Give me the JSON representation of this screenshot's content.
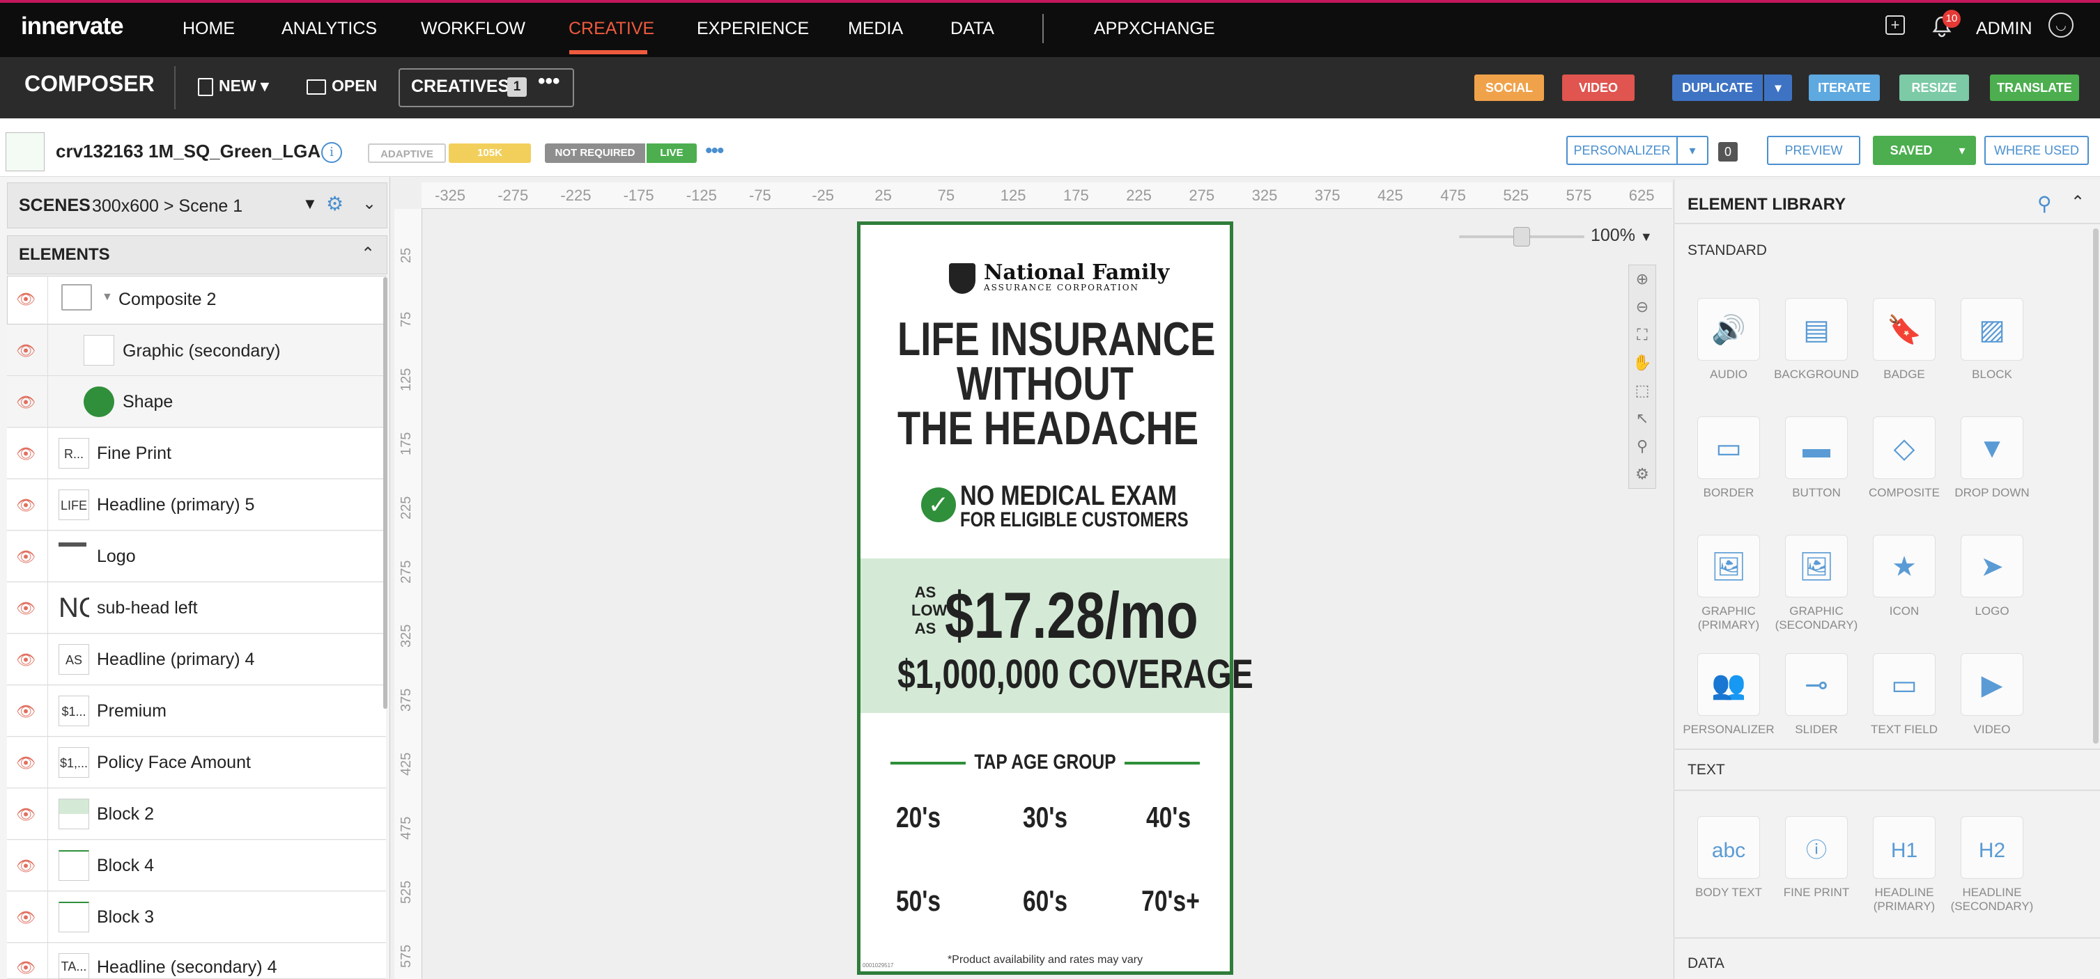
{
  "nav": {
    "brand": "innervate",
    "items": [
      "HOME",
      "ANALYTICS",
      "WORKFLOW",
      "CREATIVE",
      "EXPERIENCE",
      "MEDIA",
      "DATA",
      "APPXCHANGE"
    ],
    "notification_count": "10",
    "user": "ADMIN"
  },
  "composer": {
    "title": "COMPOSER",
    "new_label": "NEW",
    "open_label": "OPEN",
    "creatives_label": "CREATIVES",
    "creatives_count": "1",
    "actions": [
      "SOCIAL",
      "VIDEO",
      "DUPLICATE",
      "ITERATE",
      "RESIZE",
      "TRANSLATE"
    ],
    "action_colors": [
      "#f0a24a",
      "#e0554f",
      "#3e73c4",
      "#5ea9e0",
      "#7ccaa6",
      "#4cae4f"
    ]
  },
  "creative": {
    "name": "crv132163 1M_SQ_Green_LGA",
    "chips": [
      "ADAPTIVE",
      "105K",
      "NOT REQUIRED",
      "LIVE"
    ],
    "personalizer_label": "PERSONALIZER",
    "personalizer_count": "0",
    "preview_label": "PREVIEW",
    "saved_label": "SAVED",
    "where_used_label": "WHERE USED"
  },
  "scenes": {
    "label": "SCENES",
    "value": "300x600 > Scene 1"
  },
  "elements": {
    "label": "ELEMENTS",
    "rows": [
      {
        "name": "Composite 2",
        "thumb": ""
      },
      {
        "name": "Graphic (secondary)",
        "thumb": ""
      },
      {
        "name": "Shape",
        "thumb": ""
      },
      {
        "name": "Fine Print",
        "thumb": "R..."
      },
      {
        "name": "Headline (primary) 5",
        "thumb": "LIFE"
      },
      {
        "name": "Logo",
        "thumb": ""
      },
      {
        "name": "sub-head left",
        "thumb": "NO"
      },
      {
        "name": "Headline (primary) 4",
        "thumb": "AS"
      },
      {
        "name": "Premium",
        "thumb": "$1..."
      },
      {
        "name": "Policy Face Amount",
        "thumb": "$1,..."
      },
      {
        "name": "Block 2",
        "thumb": ""
      },
      {
        "name": "Block 4",
        "thumb": ""
      },
      {
        "name": "Block 3",
        "thumb": ""
      },
      {
        "name": "Headline (secondary) 4",
        "thumb": "TA..."
      }
    ]
  },
  "canvas": {
    "zoom": "100%",
    "ruler_top": [
      "-325",
      "-275",
      "-225",
      "-175",
      "-125",
      "-75",
      "-25",
      "25",
      "75",
      "125",
      "175",
      "225",
      "275",
      "325",
      "375",
      "425",
      "475",
      "525",
      "575",
      "625"
    ],
    "ruler_left": [
      "25",
      "75",
      "125",
      "175",
      "225",
      "275",
      "325",
      "375",
      "425",
      "475",
      "525",
      "575"
    ]
  },
  "ad": {
    "brand": "National Family",
    "brand_sub": "ASSURANCE CORPORATION",
    "headline": [
      "LIFE INSURANCE",
      "WITHOUT",
      "THE HEADACHE"
    ],
    "sub1": "NO MEDICAL EXAM",
    "sub2": "FOR ELIGIBLE CUSTOMERS",
    "as_low_as": [
      "AS",
      "LOW",
      "AS"
    ],
    "price": "$17.28/mo",
    "coverage": "$1,000,000 COVERAGE",
    "tap": "TAP AGE GROUP",
    "ages": [
      "20's",
      "30's",
      "40's",
      "50's",
      "60's",
      "70's+"
    ],
    "disclaimer": "*Product availability and rates may vary",
    "code": "0001029517"
  },
  "library": {
    "title": "ELEMENT LIBRARY",
    "standard_label": "STANDARD",
    "standard": [
      "AUDIO",
      "BACKGROUND",
      "BADGE",
      "BLOCK",
      "BORDER",
      "BUTTON",
      "COMPOSITE",
      "DROP DOWN",
      "GRAPHIC (PRIMARY)",
      "GRAPHIC (SECONDARY)",
      "ICON",
      "LOGO",
      "PERSONALIZER",
      "SLIDER",
      "TEXT FIELD",
      "VIDEO"
    ],
    "text_label": "TEXT",
    "text": [
      "BODY TEXT",
      "FINE PRINT",
      "HEADLINE (PRIMARY)",
      "HEADLINE (SECONDARY)"
    ],
    "data_label": "DATA"
  }
}
